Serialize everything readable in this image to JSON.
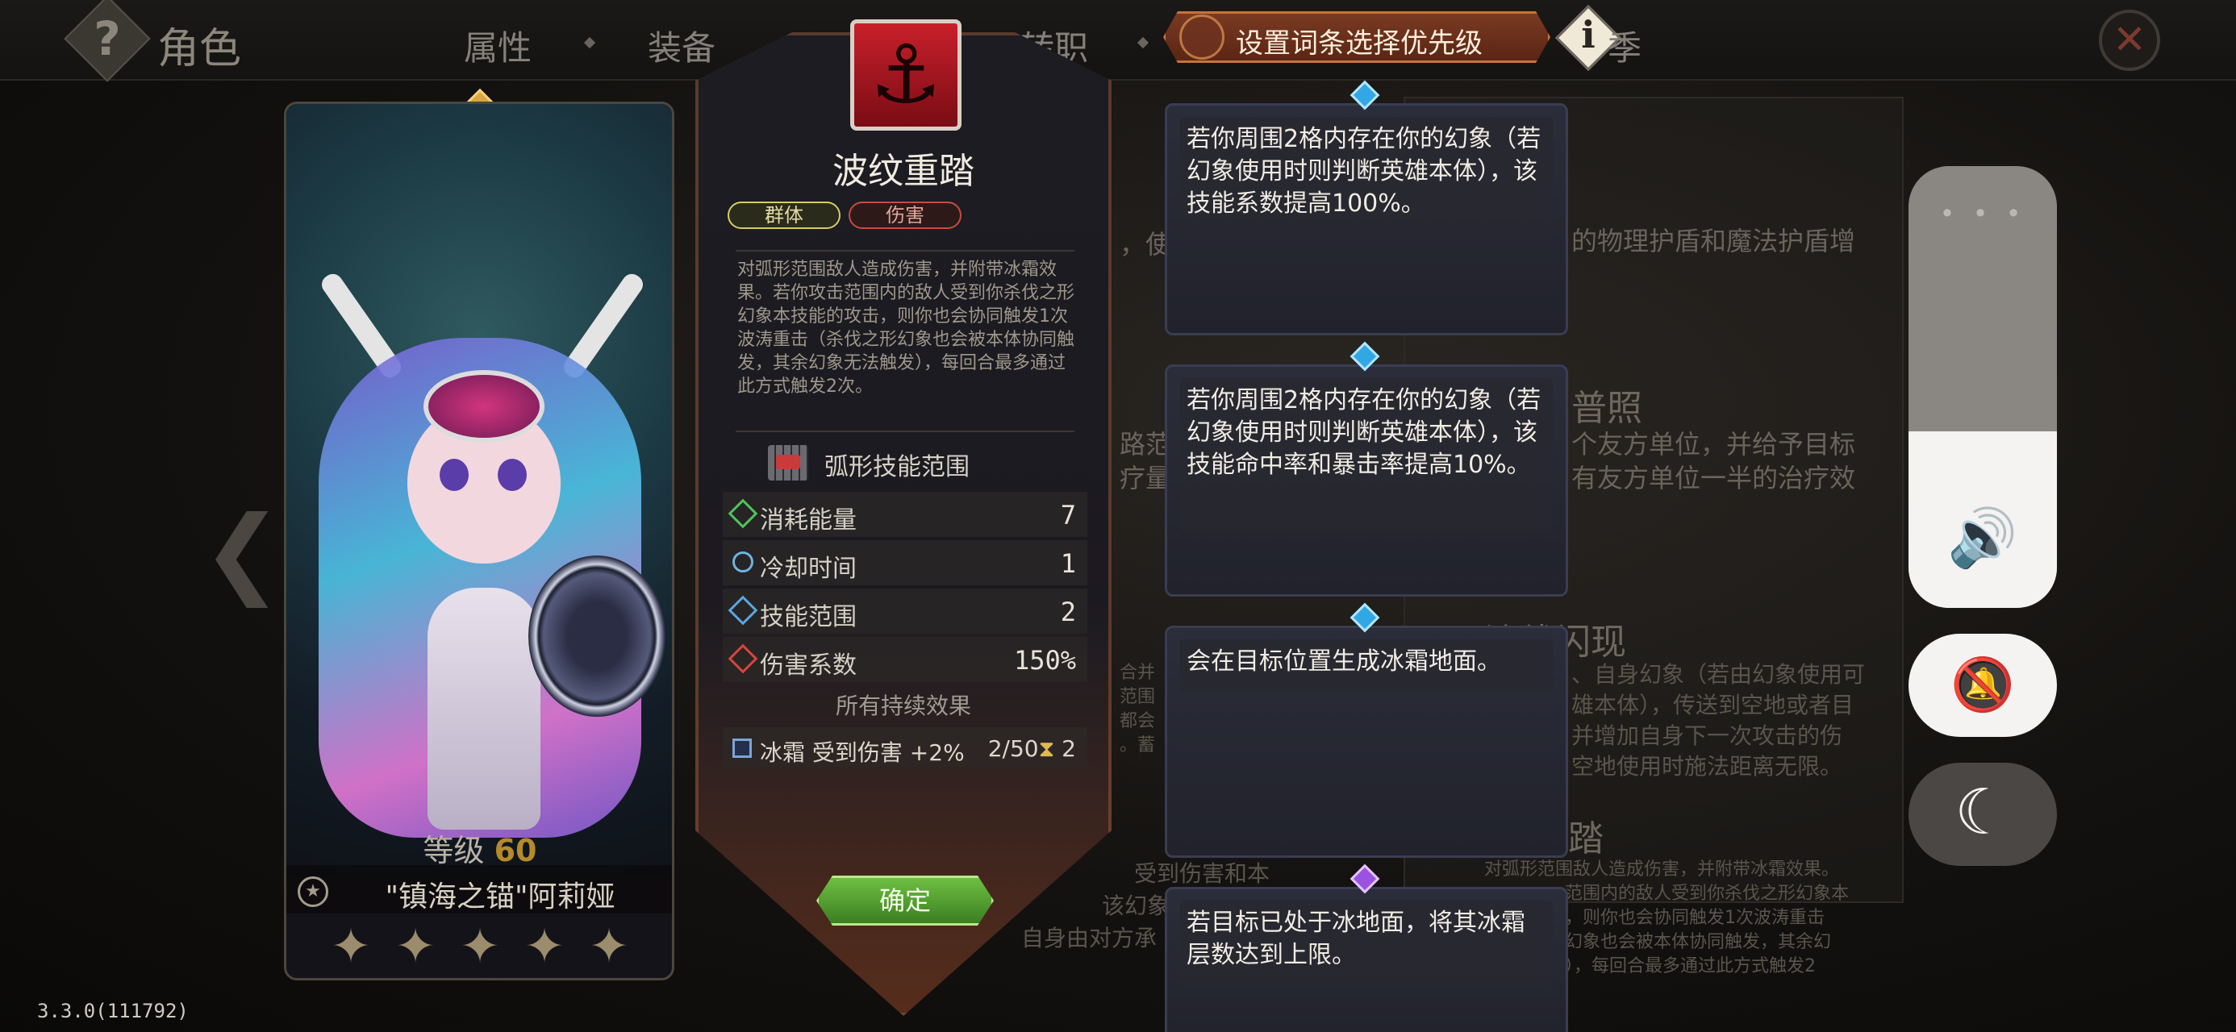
{
  "topbar": {
    "title": "角色",
    "tabs": [
      "属性",
      "装备",
      "转职"
    ],
    "priority_button": "设置词条选择优先级",
    "season_tab": "季"
  },
  "background": {
    "left_fragment_1": "，使",
    "right_fragment_1": "的物理护盾和魔法护盾增",
    "head_1": "普照",
    "fragment_2a": "个友方单位，并给予目标",
    "fragment_2b": "有友方单位一半的治疗效",
    "left_fragment_2a": "路范",
    "left_fragment_2b": "疗量",
    "head_2": "流线闪现",
    "fragment_3a": "、自身幻象（若由幻象使用可",
    "fragment_3b": "雄本体），传送到空地或者目",
    "fragment_3c": "并增加自身下一次攻击的伤",
    "fragment_3d": "空地使用时施法距离无限。",
    "left_fragment_3a": "合并",
    "left_fragment_3b": "范围",
    "left_fragment_3c": "都会",
    "left_fragment_3d": "。蓄",
    "head_3": "重踏",
    "fragment_4a": "对弧形范围敌人造成伤害，并附带冰霜效果。",
    "fragment_4b": "范围内的敌人受到你杀伐之形幻象本",
    "fragment_4c": "，则你也会协同触发1次波涛重击",
    "fragment_4d": "幻象也会被本体协同触发，其余幻",
    "fragment_4e": "），每回合最多通过此方式触发2",
    "mid_fragment_a": "受到伤害和本",
    "mid_fragment_b": "该幻象",
    "mid_fragment_c": "自身由对方承"
  },
  "character": {
    "level_label": "等级",
    "level": "60",
    "name": "\"镇海之锚\"阿莉娅",
    "stars": [
      "✦",
      "✦",
      "✦",
      "✦",
      "✦"
    ]
  },
  "skill": {
    "name": "波纹重踏",
    "tags": [
      "群体",
      "伤害"
    ],
    "description": "对弧形范围敌人造成伤害，并附带冰霜效果。若你攻击范围内的敌人受到你杀伐之形幻象本技能的攻击，则你也会协同触发1次波涛重击（杀伐之形幻象也会被本体协同触发，其余幻象无法触发），每回合最多通过此方式触发2次。",
    "range_type": "弧形技能范围",
    "stats": [
      {
        "label": "消耗能量",
        "value": "7",
        "color": "#4fc35a"
      },
      {
        "label": "冷却时间",
        "value": "1",
        "color": "#6fb3e0"
      },
      {
        "label": "技能范围",
        "value": "2",
        "color": "#5aa7e0"
      },
      {
        "label": "伤害系数",
        "value": "150%",
        "color": "#d6453a"
      }
    ],
    "effects_heading": "所有持续效果",
    "effect": {
      "label": "冰霜 受到伤害 +2%",
      "stacks": "2/50",
      "hourglass": "⧗",
      "duration": "2"
    },
    "confirm": "确定"
  },
  "affixes": [
    "若你周围2格内存在你的幻象（若幻象使用时则判断英雄本体），该技能系数提高100%。",
    "若你周围2格内存在你的幻象（若幻象使用时则判断英雄本体），该技能命中率和暴击率提高10%。",
    "会在目标位置生成冰霜地面。",
    "若目标已处于冰地面，将其冰霜层数达到上限。"
  ],
  "system_controls": {
    "volume_level": 0.4,
    "dots": "• • •",
    "speaker_icon": "🔊",
    "bell_icon": "🔕",
    "moon_icon": "☾"
  },
  "version": "3.3.0(111792)"
}
